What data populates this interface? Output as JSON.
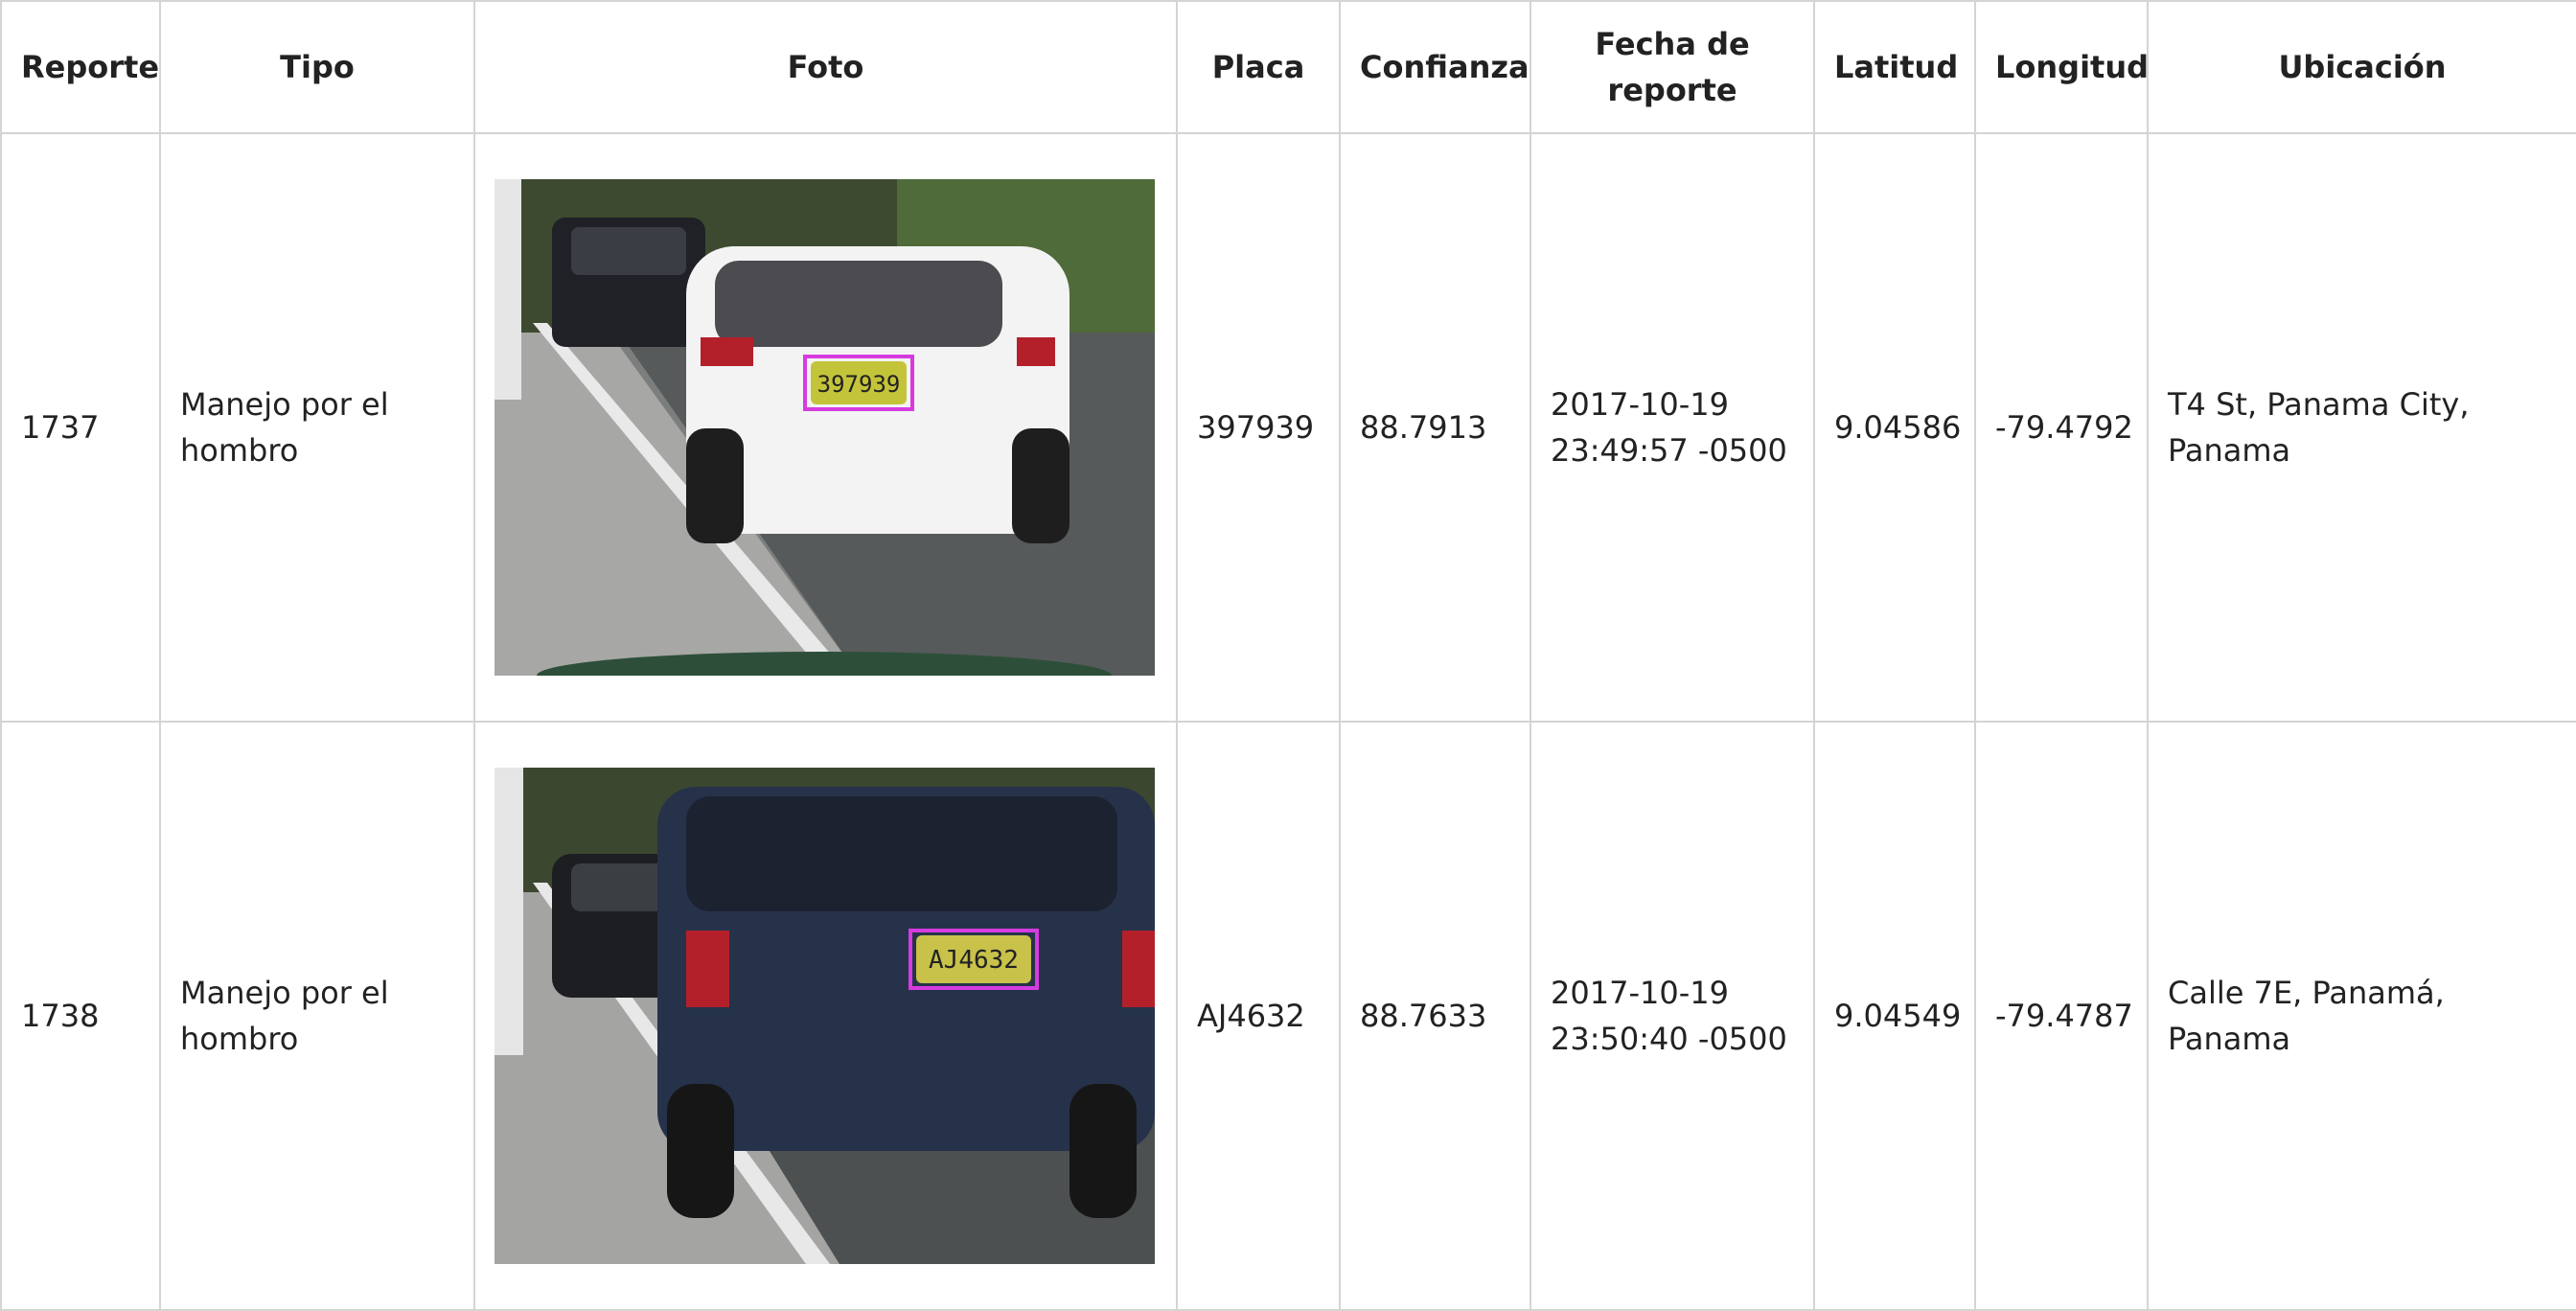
{
  "table": {
    "headers": [
      "Reporte",
      "Tipo",
      "Foto",
      "Placa",
      "Confianza",
      "Fecha de reporte",
      "Latitud",
      "Longitud",
      "Ubicación"
    ],
    "rows": [
      {
        "reporte": "1737",
        "tipo": "Manejo por el hombro",
        "foto": {
          "plate_text": "397939",
          "vehicle": "white sedan",
          "box_color": "#d63be0"
        },
        "placa": "397939",
        "confianza": "88.7913",
        "fecha_line1": "2017-10-19",
        "fecha_line2": "23:49:57 -0500",
        "latitud": "9.04586",
        "longitud": "-79.4792",
        "ubicacion": "T4 St, Panama City, Panama"
      },
      {
        "reporte": "1738",
        "tipo": "Manejo por el hombro",
        "foto": {
          "plate_text": "AJ4632",
          "vehicle": "dark SUV",
          "box_color": "#d63be0"
        },
        "placa": "AJ4632",
        "confianza": "88.7633",
        "fecha_line1": "2017-10-19",
        "fecha_line2": "23:50:40 -0500",
        "latitud": "9.04549",
        "longitud": "-79.4787",
        "ubicacion": "Calle 7E, Panamá, Panama"
      }
    ]
  }
}
